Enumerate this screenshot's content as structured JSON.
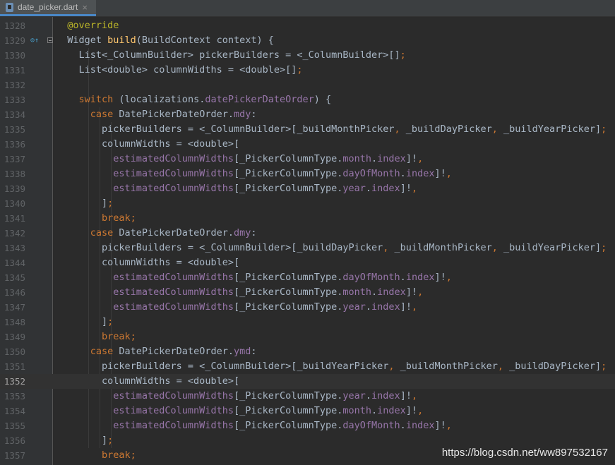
{
  "tab": {
    "filename": "date_picker.dart",
    "close": "×"
  },
  "gutter_markers": {
    "override": "⊙↑"
  },
  "current_line": "1352",
  "lines": [
    {
      "n": "1328",
      "tokens": [
        [
          "ann",
          "@override"
        ]
      ]
    },
    {
      "n": "1329",
      "tokens": [
        [
          "txt",
          "Widget "
        ],
        [
          "fn",
          "build"
        ],
        [
          "txt",
          "(BuildContext context) {"
        ]
      ]
    },
    {
      "n": "1330",
      "tokens": [
        [
          "txt",
          "  List<_ColumnBuilder> pickerBuilders = <_ColumnBuilder>[]"
        ],
        [
          "kw",
          ";"
        ]
      ]
    },
    {
      "n": "1331",
      "tokens": [
        [
          "txt",
          "  List<double> columnWidths = <double>[]"
        ],
        [
          "kw",
          ";"
        ]
      ]
    },
    {
      "n": "1332",
      "tokens": []
    },
    {
      "n": "1333",
      "tokens": [
        [
          "kw",
          "  switch "
        ],
        [
          "txt",
          "(localizations."
        ],
        [
          "fld",
          "datePickerDateOrder"
        ],
        [
          "txt",
          ") {"
        ]
      ]
    },
    {
      "n": "1334",
      "tokens": [
        [
          "kw",
          "    case "
        ],
        [
          "txt",
          "DatePickerDateOrder."
        ],
        [
          "fld",
          "mdy"
        ],
        [
          "txt",
          ":"
        ]
      ]
    },
    {
      "n": "1335",
      "tokens": [
        [
          "txt",
          "      pickerBuilders = <_ColumnBuilder>[_buildMonthPicker"
        ],
        [
          "kw",
          ", "
        ],
        [
          "txt",
          "_buildDayPicker"
        ],
        [
          "kw",
          ", "
        ],
        [
          "txt",
          "_buildYearPicker]"
        ],
        [
          "kw",
          ";"
        ]
      ]
    },
    {
      "n": "1336",
      "tokens": [
        [
          "txt",
          "      columnWidths = <double>["
        ]
      ]
    },
    {
      "n": "1337",
      "tokens": [
        [
          "fld",
          "        estimatedColumnWidths"
        ],
        [
          "txt",
          "[_PickerColumnType."
        ],
        [
          "fld",
          "month"
        ],
        [
          "txt",
          "."
        ],
        [
          "fld",
          "index"
        ],
        [
          "txt",
          "]!"
        ],
        [
          "kw",
          ","
        ]
      ]
    },
    {
      "n": "1338",
      "tokens": [
        [
          "fld",
          "        estimatedColumnWidths"
        ],
        [
          "txt",
          "[_PickerColumnType."
        ],
        [
          "fld",
          "dayOfMonth"
        ],
        [
          "txt",
          "."
        ],
        [
          "fld",
          "index"
        ],
        [
          "txt",
          "]!"
        ],
        [
          "kw",
          ","
        ]
      ]
    },
    {
      "n": "1339",
      "tokens": [
        [
          "fld",
          "        estimatedColumnWidths"
        ],
        [
          "txt",
          "[_PickerColumnType."
        ],
        [
          "fld",
          "year"
        ],
        [
          "txt",
          "."
        ],
        [
          "fld",
          "index"
        ],
        [
          "txt",
          "]!"
        ],
        [
          "kw",
          ","
        ]
      ]
    },
    {
      "n": "1340",
      "tokens": [
        [
          "txt",
          "      ]"
        ],
        [
          "kw",
          ";"
        ]
      ]
    },
    {
      "n": "1341",
      "tokens": [
        [
          "kw",
          "      break;"
        ]
      ]
    },
    {
      "n": "1342",
      "tokens": [
        [
          "kw",
          "    case "
        ],
        [
          "txt",
          "DatePickerDateOrder."
        ],
        [
          "fld",
          "dmy"
        ],
        [
          "txt",
          ":"
        ]
      ]
    },
    {
      "n": "1343",
      "tokens": [
        [
          "txt",
          "      pickerBuilders = <_ColumnBuilder>[_buildDayPicker"
        ],
        [
          "kw",
          ", "
        ],
        [
          "txt",
          "_buildMonthPicker"
        ],
        [
          "kw",
          ", "
        ],
        [
          "txt",
          "_buildYearPicker]"
        ],
        [
          "kw",
          ";"
        ]
      ]
    },
    {
      "n": "1344",
      "tokens": [
        [
          "txt",
          "      columnWidths = <double>["
        ]
      ]
    },
    {
      "n": "1345",
      "tokens": [
        [
          "fld",
          "        estimatedColumnWidths"
        ],
        [
          "txt",
          "[_PickerColumnType."
        ],
        [
          "fld",
          "dayOfMonth"
        ],
        [
          "txt",
          "."
        ],
        [
          "fld",
          "index"
        ],
        [
          "txt",
          "]!"
        ],
        [
          "kw",
          ","
        ]
      ]
    },
    {
      "n": "1346",
      "tokens": [
        [
          "fld",
          "        estimatedColumnWidths"
        ],
        [
          "txt",
          "[_PickerColumnType."
        ],
        [
          "fld",
          "month"
        ],
        [
          "txt",
          "."
        ],
        [
          "fld",
          "index"
        ],
        [
          "txt",
          "]!"
        ],
        [
          "kw",
          ","
        ]
      ]
    },
    {
      "n": "1347",
      "tokens": [
        [
          "fld",
          "        estimatedColumnWidths"
        ],
        [
          "txt",
          "[_PickerColumnType."
        ],
        [
          "fld",
          "year"
        ],
        [
          "txt",
          "."
        ],
        [
          "fld",
          "index"
        ],
        [
          "txt",
          "]!"
        ],
        [
          "kw",
          ","
        ]
      ]
    },
    {
      "n": "1348",
      "tokens": [
        [
          "txt",
          "      ]"
        ],
        [
          "kw",
          ";"
        ]
      ]
    },
    {
      "n": "1349",
      "tokens": [
        [
          "kw",
          "      break;"
        ]
      ]
    },
    {
      "n": "1350",
      "tokens": [
        [
          "kw",
          "    case "
        ],
        [
          "txt",
          "DatePickerDateOrder."
        ],
        [
          "fld",
          "ymd"
        ],
        [
          "txt",
          ":"
        ]
      ]
    },
    {
      "n": "1351",
      "tokens": [
        [
          "txt",
          "      pickerBuilders = <_ColumnBuilder>[_buildYearPicker"
        ],
        [
          "kw",
          ", "
        ],
        [
          "txt",
          "_buildMonthPicker"
        ],
        [
          "kw",
          ", "
        ],
        [
          "txt",
          "_buildDayPicker]"
        ],
        [
          "kw",
          ";"
        ]
      ]
    },
    {
      "n": "1352",
      "tokens": [
        [
          "txt",
          "      columnWidths = <double>["
        ]
      ]
    },
    {
      "n": "1353",
      "tokens": [
        [
          "fld",
          "        estimatedColumnWidths"
        ],
        [
          "txt",
          "[_PickerColumnType."
        ],
        [
          "fld",
          "year"
        ],
        [
          "txt",
          "."
        ],
        [
          "fld",
          "index"
        ],
        [
          "txt",
          "]!"
        ],
        [
          "kw",
          ","
        ]
      ]
    },
    {
      "n": "1354",
      "tokens": [
        [
          "fld",
          "        estimatedColumnWidths"
        ],
        [
          "txt",
          "[_PickerColumnType."
        ],
        [
          "fld",
          "month"
        ],
        [
          "txt",
          "."
        ],
        [
          "fld",
          "index"
        ],
        [
          "txt",
          "]!"
        ],
        [
          "kw",
          ","
        ]
      ]
    },
    {
      "n": "1355",
      "tokens": [
        [
          "fld",
          "        estimatedColumnWidths"
        ],
        [
          "txt",
          "[_PickerColumnType."
        ],
        [
          "fld",
          "dayOfMonth"
        ],
        [
          "txt",
          "."
        ],
        [
          "fld",
          "index"
        ],
        [
          "txt",
          "]!"
        ],
        [
          "kw",
          ","
        ]
      ]
    },
    {
      "n": "1356",
      "tokens": [
        [
          "txt",
          "      ]"
        ],
        [
          "kw",
          ";"
        ]
      ]
    },
    {
      "n": "1357",
      "tokens": [
        [
          "kw",
          "      break;"
        ]
      ]
    }
  ],
  "watermark": "https://blog.csdn.net/ww897532167",
  "colors": {
    "background": "#2b2b2b",
    "gutter": "#313335",
    "annotation": "#bbb529",
    "keyword": "#cc7832",
    "function": "#ffc66d",
    "field": "#9876aa",
    "text": "#a9b7c6",
    "line_number": "#606366"
  }
}
